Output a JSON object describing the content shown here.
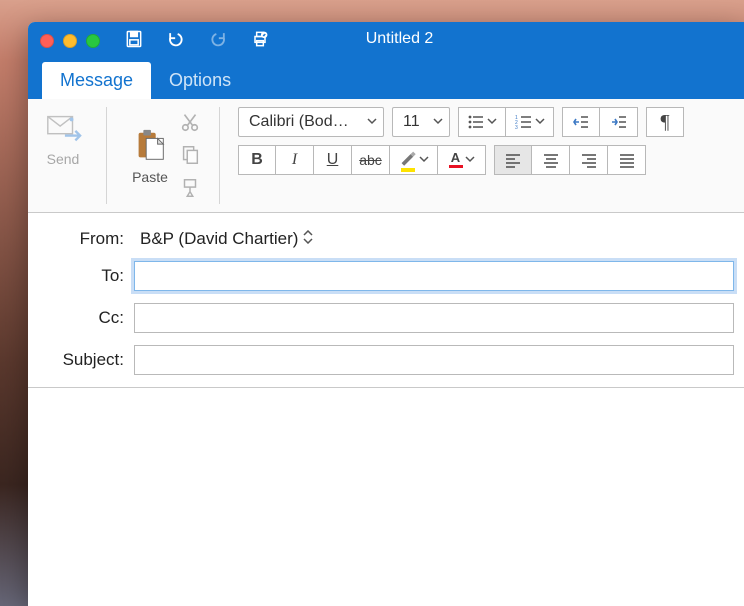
{
  "window": {
    "title": "Untitled 2"
  },
  "tabs": {
    "message": "Message",
    "options": "Options",
    "active": "message"
  },
  "ribbon": {
    "send": "Send",
    "paste": "Paste",
    "font_name": "Calibri (Bod…",
    "font_size": "11",
    "bold": "B",
    "italic": "I",
    "underline": "U",
    "strike": "abc",
    "font_color_letter": "A"
  },
  "fields": {
    "from_label": "From:",
    "from_value": "B&P (David Chartier)",
    "to_label": "To:",
    "to_value": "",
    "cc_label": "Cc:",
    "cc_value": "",
    "subject_label": "Subject:",
    "subject_value": ""
  },
  "colors": {
    "chrome_blue": "#1273cf",
    "highlight_yellow": "#fee300",
    "font_red": "#e81123"
  }
}
